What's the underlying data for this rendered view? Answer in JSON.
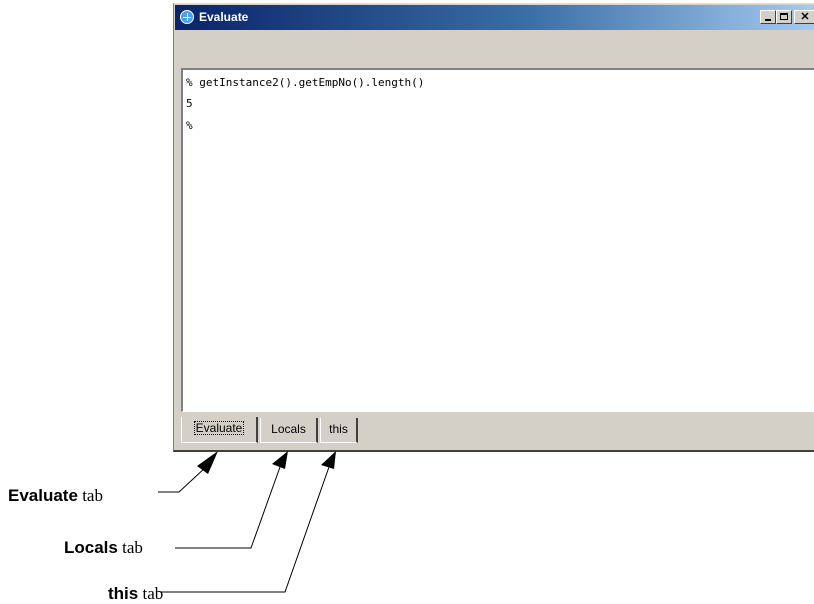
{
  "window": {
    "title": "Evaluate",
    "icon": "globe-icon",
    "controls": {
      "minimize": "minimize-icon",
      "maximize": "maximize-icon",
      "close": "close-icon"
    }
  },
  "console": {
    "lines": [
      "% getInstance2().getEmpNo().length()",
      "5",
      "%"
    ]
  },
  "tabs": [
    {
      "label": "Evaluate",
      "selected": true
    },
    {
      "label": "Locals",
      "selected": false
    },
    {
      "label": "this",
      "selected": false
    }
  ],
  "callouts": [
    {
      "bold": "Evaluate",
      "rest": " tab"
    },
    {
      "bold": "Locals",
      "rest": " tab"
    },
    {
      "bold": "this",
      "rest": " tab"
    }
  ]
}
